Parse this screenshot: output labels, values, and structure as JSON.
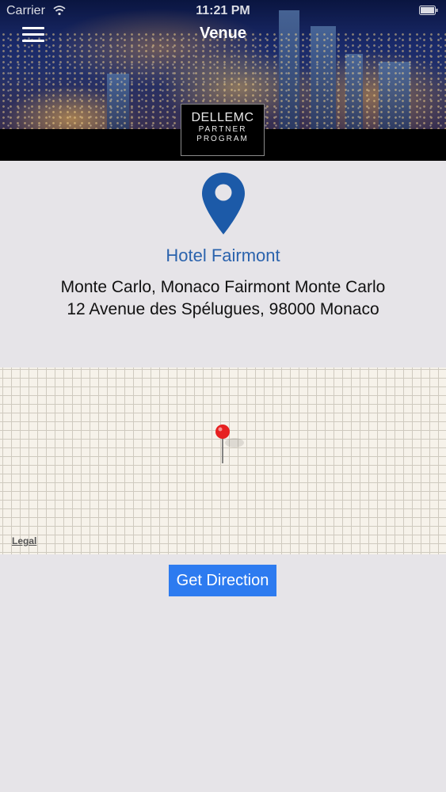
{
  "status_bar": {
    "carrier": "Carrier",
    "time": "11:21 PM"
  },
  "header": {
    "title": "Venue",
    "menu_icon": "hamburger-menu-icon",
    "logo": {
      "brand": "DELLEMC",
      "line1": "PARTNER",
      "line2": "PROGRAM"
    }
  },
  "venue": {
    "icon": "location-pin-icon",
    "name": "Hotel Fairmont",
    "address_line1": "Monte Carlo, Monaco Fairmont Monte Carlo",
    "address_line2": "12 Avenue des Spélugues, 98000 Monaco"
  },
  "map": {
    "legal_label": "Legal",
    "pin_icon": "map-pin-icon"
  },
  "actions": {
    "get_direction_label": "Get Direction"
  },
  "colors": {
    "accent": "#2d7bf0",
    "venue_name": "#2b63ad",
    "pin": "#1c5aa8",
    "background": "#e6e4e8"
  }
}
